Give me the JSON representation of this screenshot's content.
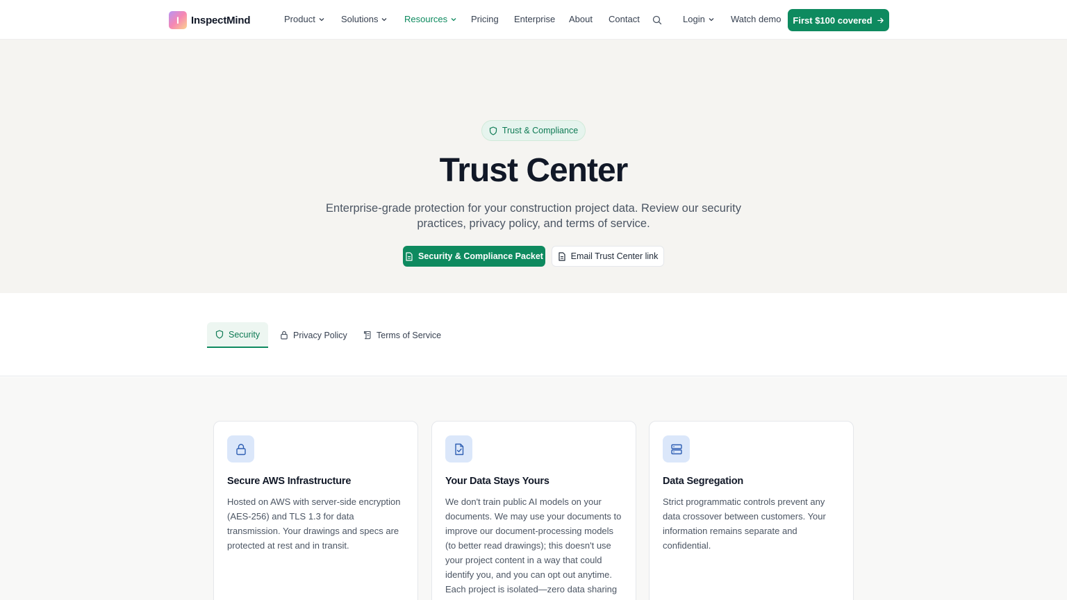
{
  "nav": {
    "brand_initial": "I",
    "brand_name": "InspectMind",
    "items": [
      {
        "label": "Product",
        "dropdown": true
      },
      {
        "label": "Solutions",
        "dropdown": true
      },
      {
        "label": "Resources",
        "dropdown": true,
        "active": true
      },
      {
        "label": "Pricing"
      },
      {
        "label": "Enterprise"
      },
      {
        "label": "About"
      },
      {
        "label": "Contact"
      }
    ],
    "login_label": "Login",
    "watch_demo_label": "Watch demo",
    "cta_label": "First $100 covered"
  },
  "hero": {
    "badge": "Trust & Compliance",
    "title": "Trust Center",
    "subtitle": "Enterprise-grade protection for your construction project data. Review our security practices, privacy policy, and terms of service.",
    "primary_button": "Security & Compliance Packet",
    "secondary_button": "Email Trust Center link"
  },
  "tabs": [
    {
      "label": "Security",
      "icon": "shield-icon",
      "active": true
    },
    {
      "label": "Privacy Policy",
      "icon": "lock-icon"
    },
    {
      "label": "Terms of Service",
      "icon": "scroll-icon"
    }
  ],
  "cards": [
    {
      "icon": "lock-icon",
      "title": "Secure AWS Infrastructure",
      "text": "Hosted on AWS with server-side encryption (AES-256) and TLS 1.3 for data transmission. Your drawings and specs are protected at rest and in transit."
    },
    {
      "icon": "file-check-icon",
      "title": "Your Data Stays Yours",
      "text": "We don't train public AI models on your documents. We may use your documents to improve our document-processing models (to better read drawings); this doesn't use your project content in a way that could identify you, and you can opt out anytime. Each project is isolated—zero data sharing between customers."
    },
    {
      "icon": "server-icon",
      "title": "Data Segregation",
      "text": "Strict programmatic controls prevent any data crossover between customers. Your information remains separate and confidential."
    }
  ],
  "colors": {
    "accent": "#0e8a5f",
    "hero_bg": "#f5f4f1",
    "icon_bg": "#dbe7fa",
    "icon_stroke": "#2f5fb3"
  }
}
